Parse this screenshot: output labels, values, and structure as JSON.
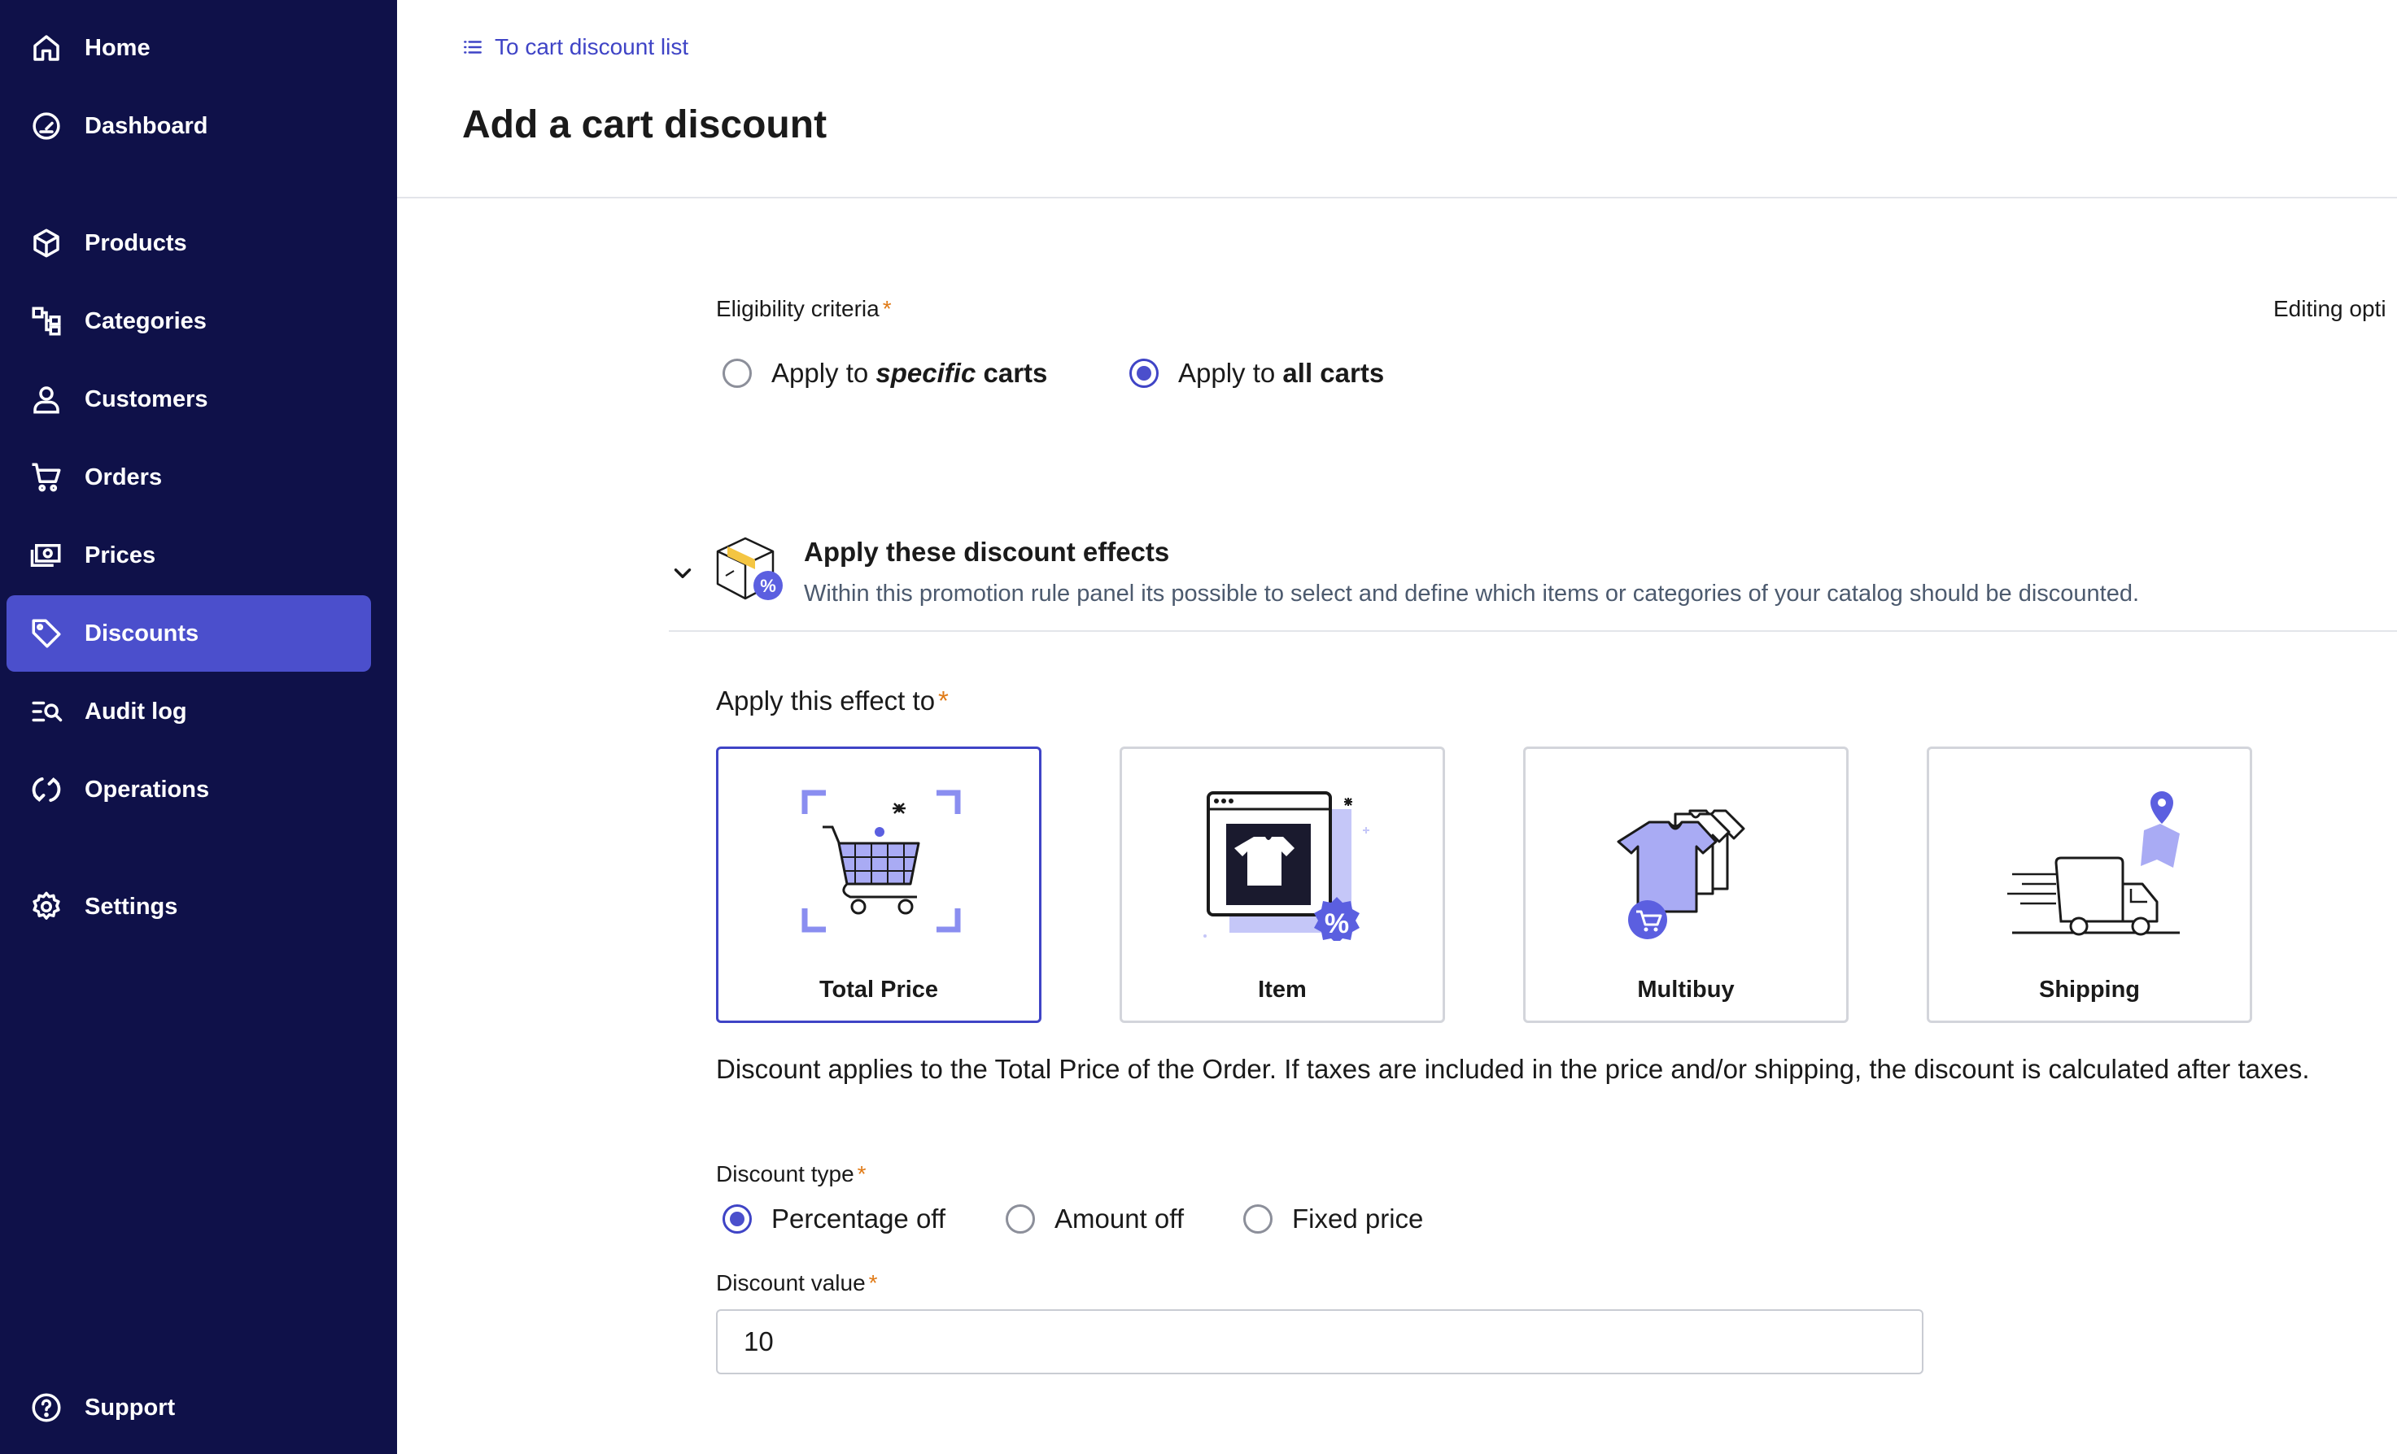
{
  "sidebar": {
    "items": [
      {
        "label": "Home",
        "icon": "home-icon"
      },
      {
        "label": "Dashboard",
        "icon": "gauge-icon"
      },
      {
        "label": "Products",
        "icon": "cube-icon"
      },
      {
        "label": "Categories",
        "icon": "hierarchy-icon"
      },
      {
        "label": "Customers",
        "icon": "user-icon"
      },
      {
        "label": "Orders",
        "icon": "cart-icon"
      },
      {
        "label": "Prices",
        "icon": "money-icon"
      },
      {
        "label": "Discounts",
        "icon": "tag-icon"
      },
      {
        "label": "Audit log",
        "icon": "search-list-icon"
      },
      {
        "label": "Operations",
        "icon": "refresh-icon"
      },
      {
        "label": "Settings",
        "icon": "gear-icon"
      },
      {
        "label": "Support",
        "icon": "help-icon"
      }
    ],
    "active": "Discounts"
  },
  "header": {
    "back_link": "To cart discount list",
    "title": "Add a cart discount"
  },
  "eligibility": {
    "label": "Eligibility criteria",
    "required_mark": "*",
    "editing_options": "Editing opti",
    "options": [
      {
        "prefix": "Apply to ",
        "emphasis": "specific",
        "suffix": " carts",
        "checked": false
      },
      {
        "prefix": "Apply to ",
        "emphasis": "all carts",
        "suffix": "",
        "checked": true
      }
    ]
  },
  "effects": {
    "title": "Apply these discount effects",
    "subtitle": "Within this promotion rule panel its possible to select and define which items or categories of your catalog should be discounted.",
    "apply_to_label": "Apply this effect to",
    "required_mark": "*",
    "targets": [
      {
        "label": "Total Price",
        "selected": true
      },
      {
        "label": "Item",
        "selected": false
      },
      {
        "label": "Multibuy",
        "selected": false
      },
      {
        "label": "Shipping",
        "selected": false
      }
    ],
    "description": "Discount applies to the Total Price of the Order. If taxes are included in the price and/or shipping, the discount is calculated after taxes."
  },
  "discount_type": {
    "label": "Discount type",
    "required_mark": "*",
    "options": [
      {
        "label": "Percentage off",
        "checked": true
      },
      {
        "label": "Amount off",
        "checked": false
      },
      {
        "label": "Fixed price",
        "checked": false
      }
    ]
  },
  "discount_value": {
    "label": "Discount value",
    "required_mark": "*",
    "value": "10"
  },
  "colors": {
    "sidebar_bg": "#0f1149",
    "accent": "#4b4fcc",
    "link": "#3f44c6",
    "required": "#e07a16"
  }
}
